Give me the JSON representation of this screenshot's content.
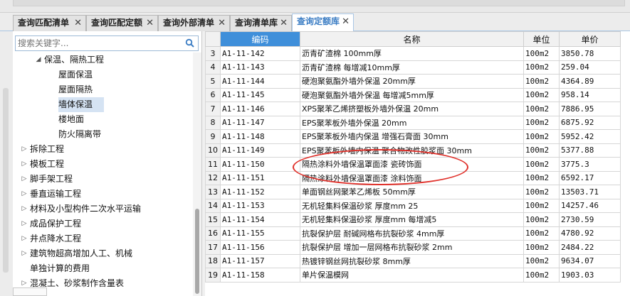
{
  "tabs": [
    {
      "label": "查询匹配清单",
      "close": "✕"
    },
    {
      "label": "查询匹配定额",
      "close": "✕"
    },
    {
      "label": "查询外部清单",
      "close": "✕"
    },
    {
      "label": "查询清单库",
      "close": "✕"
    },
    {
      "label": "查询定额库",
      "close": "✕",
      "active": true
    }
  ],
  "search": {
    "placeholder": "搜索关键字..."
  },
  "tree": [
    {
      "label": "保温、隔热工程",
      "indent": 1,
      "toggle": "◢"
    },
    {
      "label": "屋面保温",
      "indent": 3
    },
    {
      "label": "屋面隔热",
      "indent": 3
    },
    {
      "label": "墙体保温",
      "indent": 3,
      "selected": true
    },
    {
      "label": "楼地面",
      "indent": 3
    },
    {
      "label": "防火隔离带",
      "indent": 3
    },
    {
      "label": "拆除工程",
      "indent": 0,
      "toggle": "▷"
    },
    {
      "label": "模板工程",
      "indent": 0,
      "toggle": "▷"
    },
    {
      "label": "脚手架工程",
      "indent": 0,
      "toggle": "▷"
    },
    {
      "label": "垂直运输工程",
      "indent": 0,
      "toggle": "▷"
    },
    {
      "label": "材料及小型构件二次水平运输",
      "indent": 0,
      "toggle": "▷"
    },
    {
      "label": "成品保护工程",
      "indent": 0,
      "toggle": "▷"
    },
    {
      "label": "井点降水工程",
      "indent": 0,
      "toggle": "▷"
    },
    {
      "label": "建筑物超高增加人工、机械",
      "indent": 0,
      "toggle": "▷"
    },
    {
      "label": "单独计算的费用",
      "indent": 0
    },
    {
      "label": "混凝土、砂浆制作含量表",
      "indent": 0,
      "toggle": "▷"
    }
  ],
  "table": {
    "headers": {
      "rownum": "",
      "code": "编码",
      "name": "名称",
      "unit": "单位",
      "price": "单价"
    },
    "rows": [
      {
        "n": "3",
        "code": "A1-11-142",
        "name": "沥青矿渣棉 100mm厚",
        "unit": "100m2",
        "price": "3850.78"
      },
      {
        "n": "4",
        "code": "A1-11-143",
        "name": "沥青矿渣棉 每增减10mm厚",
        "unit": "100m2",
        "price": "259.04"
      },
      {
        "n": "5",
        "code": "A1-11-144",
        "name": "硬泡聚氨酯外墙外保温 20mm厚",
        "unit": "100m2",
        "price": "4364.89"
      },
      {
        "n": "6",
        "code": "A1-11-145",
        "name": "硬泡聚氨酯外墙外保温 每增减5mm厚",
        "unit": "100m2",
        "price": "958.14"
      },
      {
        "n": "7",
        "code": "A1-11-146",
        "name": "XPS聚苯乙烯挤塑板外墙外保温 20mm",
        "unit": "100m2",
        "price": "7886.95"
      },
      {
        "n": "8",
        "code": "A1-11-147",
        "name": "EPS聚苯板外墙外保温 20mm",
        "unit": "100m2",
        "price": "6875.92"
      },
      {
        "n": "9",
        "code": "A1-11-148",
        "name": "EPS聚苯板外墙内保温 增强石膏面 30mm",
        "unit": "100m2",
        "price": "5952.42"
      },
      {
        "n": "10",
        "code": "A1-11-149",
        "name": "EPS聚苯板外墙内保温 聚合物改性胶浆面 30mm",
        "unit": "100m2",
        "price": "5377.88"
      },
      {
        "n": "11",
        "code": "A1-11-150",
        "name": "隔热涂料外墙保温罩面漆 瓷砖饰面",
        "unit": "100m2",
        "price": "3775.3"
      },
      {
        "n": "12",
        "code": "A1-11-151",
        "name": "隔热涂料外墙保温罩面漆 涂料饰面",
        "unit": "100m2",
        "price": "6592.17"
      },
      {
        "n": "13",
        "code": "A1-11-152",
        "name": "单面钢丝网聚苯乙烯板 50mm厚",
        "unit": "100m2",
        "price": "13503.71"
      },
      {
        "n": "14",
        "code": "A1-11-153",
        "name": "无机轻集料保温砂浆 厚度mm 25",
        "unit": "100m2",
        "price": "14257.46"
      },
      {
        "n": "15",
        "code": "A1-11-154",
        "name": "无机轻集料保温砂浆 厚度mm 每增减5",
        "unit": "100m2",
        "price": "2730.59"
      },
      {
        "n": "16",
        "code": "A1-11-155",
        "name": "抗裂保护层 耐碱网格布抗裂砂浆 4mm厚",
        "unit": "100m2",
        "price": "4780.92"
      },
      {
        "n": "17",
        "code": "A1-11-156",
        "name": "抗裂保护层 增加一层网格布抗裂砂浆 2mm",
        "unit": "100m2",
        "price": "2484.22"
      },
      {
        "n": "18",
        "code": "A1-11-157",
        "name": "热镀锌钢丝网抗裂砂浆 8mm厚",
        "unit": "100m2",
        "price": "9634.07"
      },
      {
        "n": "19",
        "code": "A1-11-158",
        "name": "单片保温模网",
        "unit": "100m2",
        "price": "1903.03"
      }
    ]
  },
  "colors": {
    "accent": "#3f8fda",
    "highlight_ellipse": "#e0302a",
    "selected_node": "#d5e3f3"
  }
}
